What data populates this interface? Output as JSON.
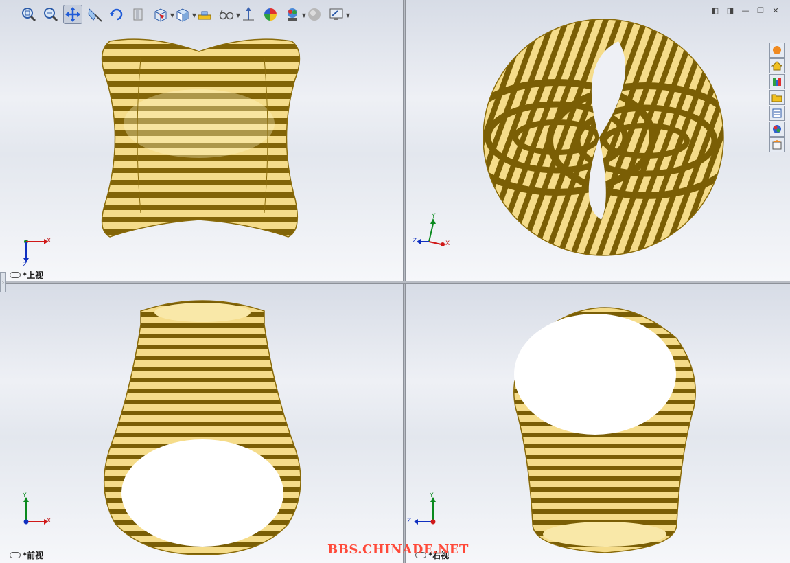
{
  "toolbar": {
    "items": [
      {
        "name": "zoom-to-fit"
      },
      {
        "name": "zoom-to-area"
      },
      {
        "name": "pan",
        "active": true
      },
      {
        "name": "section-view"
      },
      {
        "name": "rotate-view"
      },
      {
        "name": "previous-view"
      },
      {
        "name": "view-orientation"
      },
      {
        "name": "display-style"
      },
      {
        "name": "hide-show-items"
      },
      {
        "name": "edit-appearance"
      },
      {
        "name": "apply-scene"
      },
      {
        "name": "view-settings"
      }
    ]
  },
  "viewports": {
    "top": {
      "label": "*上视"
    },
    "iso": {
      "label": ""
    },
    "front": {
      "label": "*前视"
    },
    "right": {
      "label": "*右视"
    }
  },
  "axes": {
    "x": "X",
    "y": "Y",
    "z": "Z"
  },
  "watermark": "BBS.CHINADE.NET",
  "colors": {
    "gold_light": "#f7e08f",
    "gold_dark": "#7a5e05",
    "gold_mid": "#c9a227"
  }
}
